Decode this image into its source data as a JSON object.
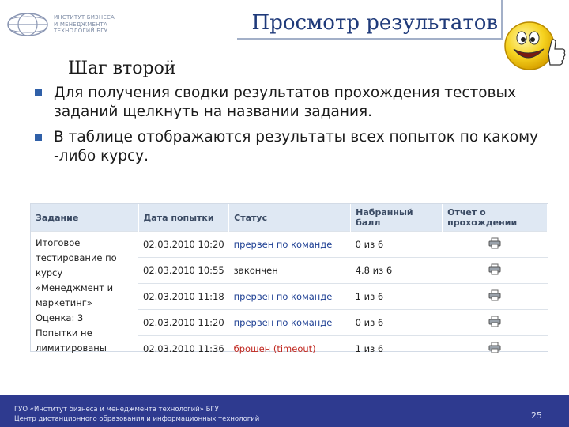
{
  "header": {
    "logo_lines": [
      "ИНСТИТУТ БИЗНЕСА",
      "И МЕНЕДЖМЕНТА",
      "ТЕХНОЛОГИЙ БГУ"
    ],
    "title": "Просмотр результатов"
  },
  "step": "Шаг второй",
  "bullets": [
    "Для получения сводки результатов прохождения тестовых заданий щелкнуть на названии задания.",
    "В таблице отображаются результаты всех попыток по какому -либо курсу."
  ],
  "table": {
    "headers": [
      "Задание",
      "Дата попытки",
      "Статус",
      "Набранный балл",
      "Отчет о прохождении"
    ],
    "task_lines": [
      "Итоговое",
      "тестирование по курсу",
      "«Менеджмент и",
      "маркетинг»",
      "Оценка: 3",
      "Попытки не",
      "лимитированы"
    ],
    "rows": [
      {
        "date": "02.03.2010 10:20",
        "status": "прервен по команде",
        "score": "0 из 6"
      },
      {
        "date": "02.03.2010 10:55",
        "status": "закончен",
        "score": "4.8 из 6"
      },
      {
        "date": "02.03.2010 11:18",
        "status": "прервен по команде",
        "score": "1 из 6"
      },
      {
        "date": "02.03.2010 11:20",
        "status": "прервен по команде",
        "score": "0 из 6"
      },
      {
        "date": "02.03.2010 11:36",
        "status": "брошен (timeout)",
        "score": "1 из 6"
      }
    ],
    "status_colors": {
      "link": "#1d3f93",
      "done": "#222222",
      "abandoned": "#c0271f"
    },
    "report_icon": "printer-icon"
  },
  "footer": {
    "line1": "ГУО «Институт бизнеса и менеджмента технологий» БГУ",
    "line2": "Центр дистанционного образования и информационных технологий",
    "page_number": "25"
  }
}
